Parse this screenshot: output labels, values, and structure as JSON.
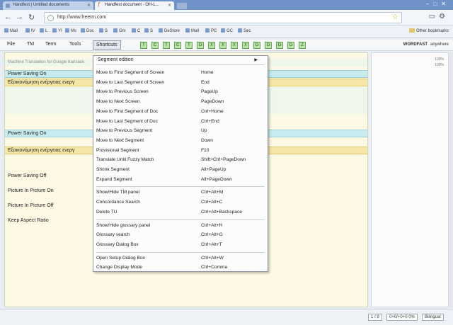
{
  "browser": {
    "tabs": [
      {
        "label": "Handfest | Untitled documents"
      },
      {
        "label": "Handfest document - OH-L..."
      }
    ],
    "url": "http://www.freetm.com",
    "bookmarks": [
      "Mail",
      "IV",
      "L",
      "YI",
      "Ms",
      "Doc",
      "S",
      "Gm",
      "C",
      "S",
      "DeStore",
      "Mall",
      "PC",
      "GC",
      "Sec"
    ],
    "bookmark_folder": "Other bookmarks"
  },
  "app": {
    "menus": [
      "File",
      "TM",
      "Term",
      "Tools",
      "Shortcuts"
    ],
    "active_menu": "Shortcuts",
    "toolbar_buttons": [
      "T",
      "C",
      "T",
      "C",
      "T",
      "D",
      "X",
      "X",
      "X",
      "X",
      "D",
      "D",
      "D",
      "D",
      "Z"
    ],
    "name": "WORDFAST",
    "user": "anywhere"
  },
  "editor": {
    "rows": [
      {
        "text": "Machine Translation for Google translate"
      },
      {
        "text": "Power Saving On"
      },
      {
        "text": "Εξοικονόμηση ενέργειας ενεργ"
      },
      {
        "text": "Power Saving On"
      },
      {
        "text": "Εξοικονόμηση ενέργειας ενεργ"
      },
      {
        "text": "Power Saving Off"
      },
      {
        "text": "Picture In Picture On"
      },
      {
        "text": "Picture In Picture Off"
      },
      {
        "text": "Keep Aspect Ratio"
      }
    ],
    "right_panel": [
      "100%",
      "100%"
    ]
  },
  "status": {
    "segment": "1 / 9",
    "counts": "0+0/+0+0 0%",
    "lang": "Bilingual"
  },
  "dropdown": {
    "header": "Segment edition",
    "groups": [
      [
        {
          "label": "Move to First Segment of Screen",
          "key": "Home"
        },
        {
          "label": "Move to Last Segment of Screen",
          "key": "End"
        },
        {
          "label": "Move to Previous Screen",
          "key": "PageUp"
        },
        {
          "label": "Move to Next Screen",
          "key": "PageDown"
        },
        {
          "label": "Move to First Segment of Doc",
          "key": "Ctrl+Home"
        },
        {
          "label": "Move to Last Segment of Doc",
          "key": "Ctrl+End"
        },
        {
          "label": "Move to Previous Segment",
          "key": "Up"
        },
        {
          "label": "Move to Next Segment",
          "key": "Down"
        },
        {
          "label": "Provisional Segment",
          "key": "F10"
        },
        {
          "label": "Translate Until Fuzzy Match",
          "key": "Shift+Ctrl+PageDown"
        },
        {
          "label": "Shrink Segment",
          "key": "Alt+PageUp"
        },
        {
          "label": "Expand Segment",
          "key": "Alt+PageDown"
        }
      ],
      [
        {
          "label": "Show/Hide TM panel",
          "key": "Ctrl+Alt+M"
        },
        {
          "label": "Concordance Search",
          "key": "Ctrl+Alt+C"
        },
        {
          "label": "Delete TU",
          "key": "Ctrl+Alt+Backspace"
        }
      ],
      [
        {
          "label": "Show/Hide glossary panel",
          "key": "Ctrl+Alt+H"
        },
        {
          "label": "Glossary search",
          "key": "Ctrl+Alt+G"
        },
        {
          "label": "Glossary Dialog Box",
          "key": "Ctrl+Alt+T"
        }
      ],
      [
        {
          "label": "Open Setup Dialog Box",
          "key": "Ctrl+Alt+W"
        },
        {
          "label": "Change Display Mode",
          "key": "Ctrl+Comma"
        }
      ]
    ]
  }
}
